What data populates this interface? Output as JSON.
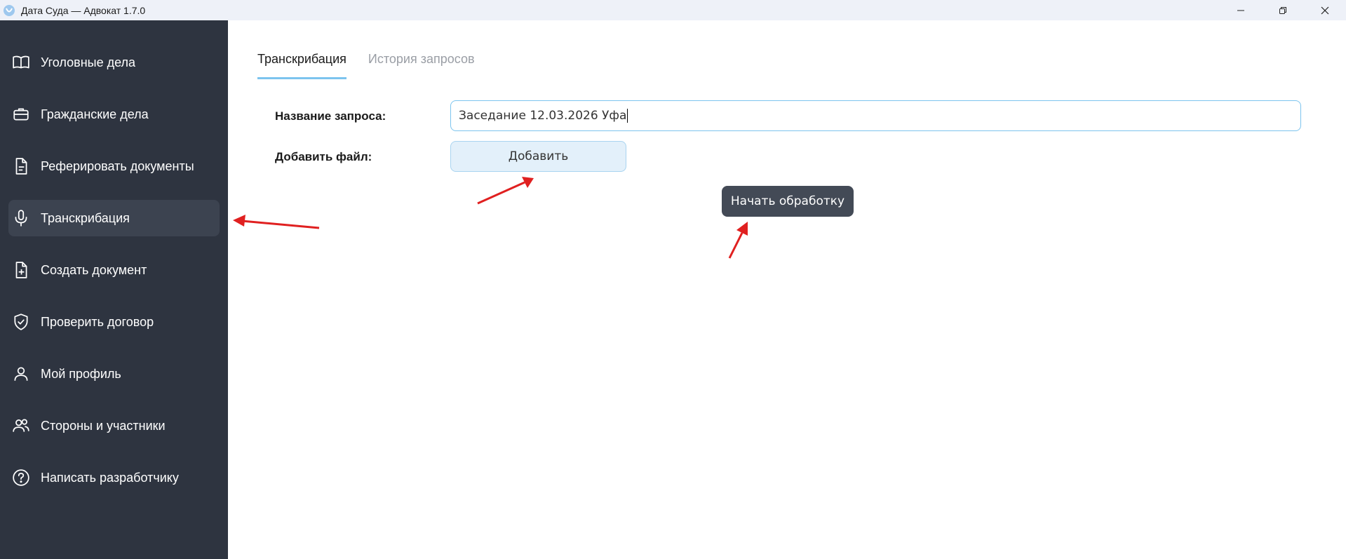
{
  "window": {
    "title": "Дата Суда — Адвокат 1.7.0"
  },
  "sidebar": {
    "items": [
      {
        "label": "Уголовные дела",
        "icon": "book-icon"
      },
      {
        "label": "Гражданские дела",
        "icon": "briefcase-icon"
      },
      {
        "label": "Реферировать документы",
        "icon": "document-icon"
      },
      {
        "label": "Транскрибация",
        "icon": "microphone-icon",
        "active": true
      },
      {
        "label": "Создать документ",
        "icon": "file-plus-icon"
      },
      {
        "label": "Проверить договор",
        "icon": "shield-check-icon"
      },
      {
        "label": "Мой профиль",
        "icon": "user-icon"
      },
      {
        "label": "Стороны и участники",
        "icon": "users-icon"
      },
      {
        "label": "Написать разработчику",
        "icon": "help-circle-icon"
      }
    ]
  },
  "main": {
    "tabs": [
      {
        "label": "Транскрибация",
        "active": true
      },
      {
        "label": "История запросов",
        "active": false
      }
    ],
    "form": {
      "name_label": "Название запроса:",
      "name_value": "Заседание 12.03.2026 Уфа",
      "file_label": "Добавить файл:",
      "add_button": "Добавить",
      "start_button": "Начать обработку"
    }
  },
  "colors": {
    "sidebar_bg": "#2e3440",
    "active_item_bg": "#3c4350",
    "accent": "#7cc4ee",
    "start_button_bg": "#434a56",
    "annotation_arrow": "#e02020"
  }
}
